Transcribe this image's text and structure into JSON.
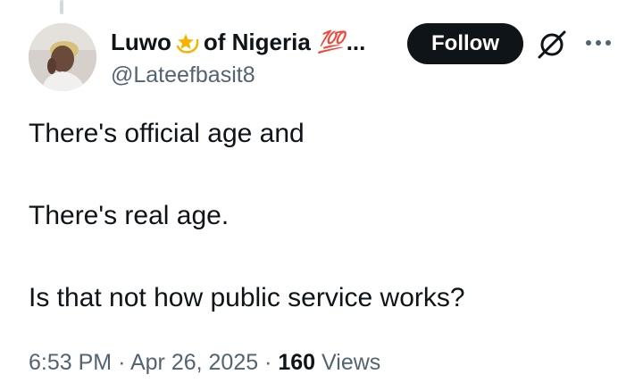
{
  "tweet": {
    "author": {
      "name_part1": "Luwo",
      "name_emoji1_icon": "dizzy-star-emoji-icon",
      "name_part2": "of Nigeria",
      "name_emoji2_icon": "hundred-points-emoji-icon",
      "name_emoji2_text": "💯",
      "name_ellipsis": "...",
      "handle": "@Lateefbasit8"
    },
    "follow_label": "Follow",
    "grok_icon": "grok-icon",
    "more_icon": "more-options-icon",
    "body_lines": [
      "There's official age and",
      "There's real age.",
      "Is that not how public service works?"
    ],
    "time": "6:53 PM",
    "separator": "·",
    "date": "Apr 26, 2025",
    "views_count": "160",
    "views_label": "Views"
  },
  "colors": {
    "text_primary": "#0f1419",
    "text_secondary": "#536471",
    "follow_bg": "#0f1419",
    "emoji_100": "#e0245e",
    "emoji_star": "#f4b400"
  }
}
